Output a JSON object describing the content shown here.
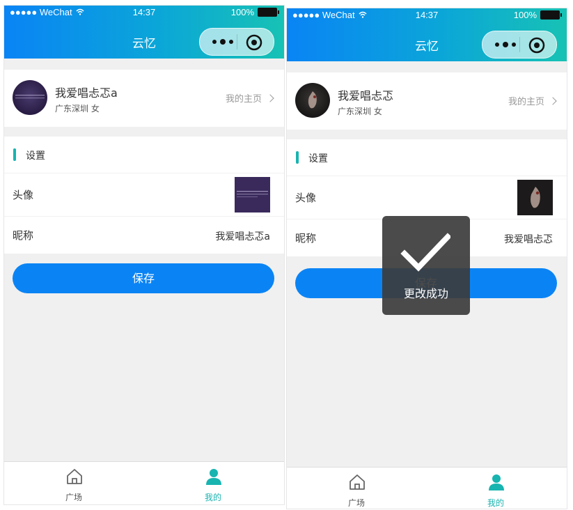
{
  "screens": [
    {
      "status": {
        "carrier": "●●●●● WeChat",
        "time": "14:37",
        "battery": "100%"
      },
      "nav_title": "云忆",
      "profile": {
        "name": "我爱唱忐忑a",
        "location": "广东深圳 女",
        "home_link": "我的主页"
      },
      "settings": {
        "title": "设置",
        "avatar_label": "头像",
        "nickname_label": "昵称",
        "nickname_value": "我爱唱忐忑a"
      },
      "save_label": "保存",
      "tabs": [
        {
          "label": "广场"
        },
        {
          "label": "我的"
        }
      ]
    },
    {
      "status": {
        "carrier": "●●●●● WeChat",
        "time": "14:37",
        "battery": "100%"
      },
      "nav_title": "云忆",
      "profile": {
        "name": "我爱唱忐忑",
        "location": "广东深圳 女",
        "home_link": "我的主页"
      },
      "settings": {
        "title": "设置",
        "avatar_label": "头像",
        "nickname_label": "昵称",
        "nickname_value": "我爱唱忐忑"
      },
      "save_label": "保存",
      "tabs": [
        {
          "label": "广场"
        },
        {
          "label": "我的"
        }
      ],
      "toast": {
        "message": "更改成功"
      }
    }
  ],
  "colors": {
    "brand_blue": "#0a84f5",
    "accent_teal": "#18b4b0",
    "background": "#f0f0f0"
  },
  "icons": [
    "wifi-icon",
    "battery-icon",
    "more-dots-icon",
    "target-icon",
    "chevron-right-icon",
    "home-icon",
    "user-icon",
    "check-icon"
  ]
}
